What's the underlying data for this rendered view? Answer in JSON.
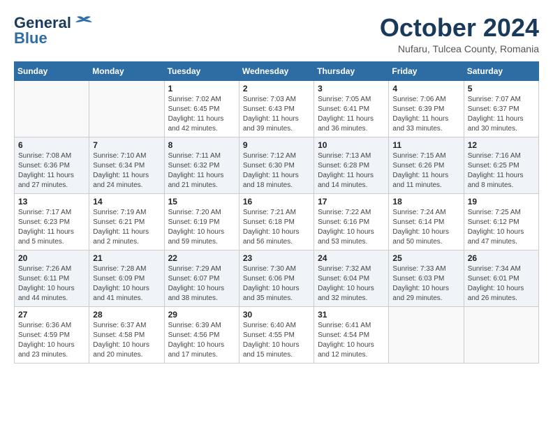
{
  "header": {
    "logo": {
      "line1": "General",
      "line2": "Blue"
    },
    "title": "October 2024",
    "location": "Nufaru, Tulcea County, Romania"
  },
  "weekdays": [
    "Sunday",
    "Monday",
    "Tuesday",
    "Wednesday",
    "Thursday",
    "Friday",
    "Saturday"
  ],
  "weeks": [
    [
      {
        "day": "",
        "info": ""
      },
      {
        "day": "",
        "info": ""
      },
      {
        "day": "1",
        "info": "Sunrise: 7:02 AM\nSunset: 6:45 PM\nDaylight: 11 hours and 42 minutes."
      },
      {
        "day": "2",
        "info": "Sunrise: 7:03 AM\nSunset: 6:43 PM\nDaylight: 11 hours and 39 minutes."
      },
      {
        "day": "3",
        "info": "Sunrise: 7:05 AM\nSunset: 6:41 PM\nDaylight: 11 hours and 36 minutes."
      },
      {
        "day": "4",
        "info": "Sunrise: 7:06 AM\nSunset: 6:39 PM\nDaylight: 11 hours and 33 minutes."
      },
      {
        "day": "5",
        "info": "Sunrise: 7:07 AM\nSunset: 6:37 PM\nDaylight: 11 hours and 30 minutes."
      }
    ],
    [
      {
        "day": "6",
        "info": "Sunrise: 7:08 AM\nSunset: 6:36 PM\nDaylight: 11 hours and 27 minutes."
      },
      {
        "day": "7",
        "info": "Sunrise: 7:10 AM\nSunset: 6:34 PM\nDaylight: 11 hours and 24 minutes."
      },
      {
        "day": "8",
        "info": "Sunrise: 7:11 AM\nSunset: 6:32 PM\nDaylight: 11 hours and 21 minutes."
      },
      {
        "day": "9",
        "info": "Sunrise: 7:12 AM\nSunset: 6:30 PM\nDaylight: 11 hours and 18 minutes."
      },
      {
        "day": "10",
        "info": "Sunrise: 7:13 AM\nSunset: 6:28 PM\nDaylight: 11 hours and 14 minutes."
      },
      {
        "day": "11",
        "info": "Sunrise: 7:15 AM\nSunset: 6:26 PM\nDaylight: 11 hours and 11 minutes."
      },
      {
        "day": "12",
        "info": "Sunrise: 7:16 AM\nSunset: 6:25 PM\nDaylight: 11 hours and 8 minutes."
      }
    ],
    [
      {
        "day": "13",
        "info": "Sunrise: 7:17 AM\nSunset: 6:23 PM\nDaylight: 11 hours and 5 minutes."
      },
      {
        "day": "14",
        "info": "Sunrise: 7:19 AM\nSunset: 6:21 PM\nDaylight: 11 hours and 2 minutes."
      },
      {
        "day": "15",
        "info": "Sunrise: 7:20 AM\nSunset: 6:19 PM\nDaylight: 10 hours and 59 minutes."
      },
      {
        "day": "16",
        "info": "Sunrise: 7:21 AM\nSunset: 6:18 PM\nDaylight: 10 hours and 56 minutes."
      },
      {
        "day": "17",
        "info": "Sunrise: 7:22 AM\nSunset: 6:16 PM\nDaylight: 10 hours and 53 minutes."
      },
      {
        "day": "18",
        "info": "Sunrise: 7:24 AM\nSunset: 6:14 PM\nDaylight: 10 hours and 50 minutes."
      },
      {
        "day": "19",
        "info": "Sunrise: 7:25 AM\nSunset: 6:12 PM\nDaylight: 10 hours and 47 minutes."
      }
    ],
    [
      {
        "day": "20",
        "info": "Sunrise: 7:26 AM\nSunset: 6:11 PM\nDaylight: 10 hours and 44 minutes."
      },
      {
        "day": "21",
        "info": "Sunrise: 7:28 AM\nSunset: 6:09 PM\nDaylight: 10 hours and 41 minutes."
      },
      {
        "day": "22",
        "info": "Sunrise: 7:29 AM\nSunset: 6:07 PM\nDaylight: 10 hours and 38 minutes."
      },
      {
        "day": "23",
        "info": "Sunrise: 7:30 AM\nSunset: 6:06 PM\nDaylight: 10 hours and 35 minutes."
      },
      {
        "day": "24",
        "info": "Sunrise: 7:32 AM\nSunset: 6:04 PM\nDaylight: 10 hours and 32 minutes."
      },
      {
        "day": "25",
        "info": "Sunrise: 7:33 AM\nSunset: 6:03 PM\nDaylight: 10 hours and 29 minutes."
      },
      {
        "day": "26",
        "info": "Sunrise: 7:34 AM\nSunset: 6:01 PM\nDaylight: 10 hours and 26 minutes."
      }
    ],
    [
      {
        "day": "27",
        "info": "Sunrise: 6:36 AM\nSunset: 4:59 PM\nDaylight: 10 hours and 23 minutes."
      },
      {
        "day": "28",
        "info": "Sunrise: 6:37 AM\nSunset: 4:58 PM\nDaylight: 10 hours and 20 minutes."
      },
      {
        "day": "29",
        "info": "Sunrise: 6:39 AM\nSunset: 4:56 PM\nDaylight: 10 hours and 17 minutes."
      },
      {
        "day": "30",
        "info": "Sunrise: 6:40 AM\nSunset: 4:55 PM\nDaylight: 10 hours and 15 minutes."
      },
      {
        "day": "31",
        "info": "Sunrise: 6:41 AM\nSunset: 4:54 PM\nDaylight: 10 hours and 12 minutes."
      },
      {
        "day": "",
        "info": ""
      },
      {
        "day": "",
        "info": ""
      }
    ]
  ]
}
